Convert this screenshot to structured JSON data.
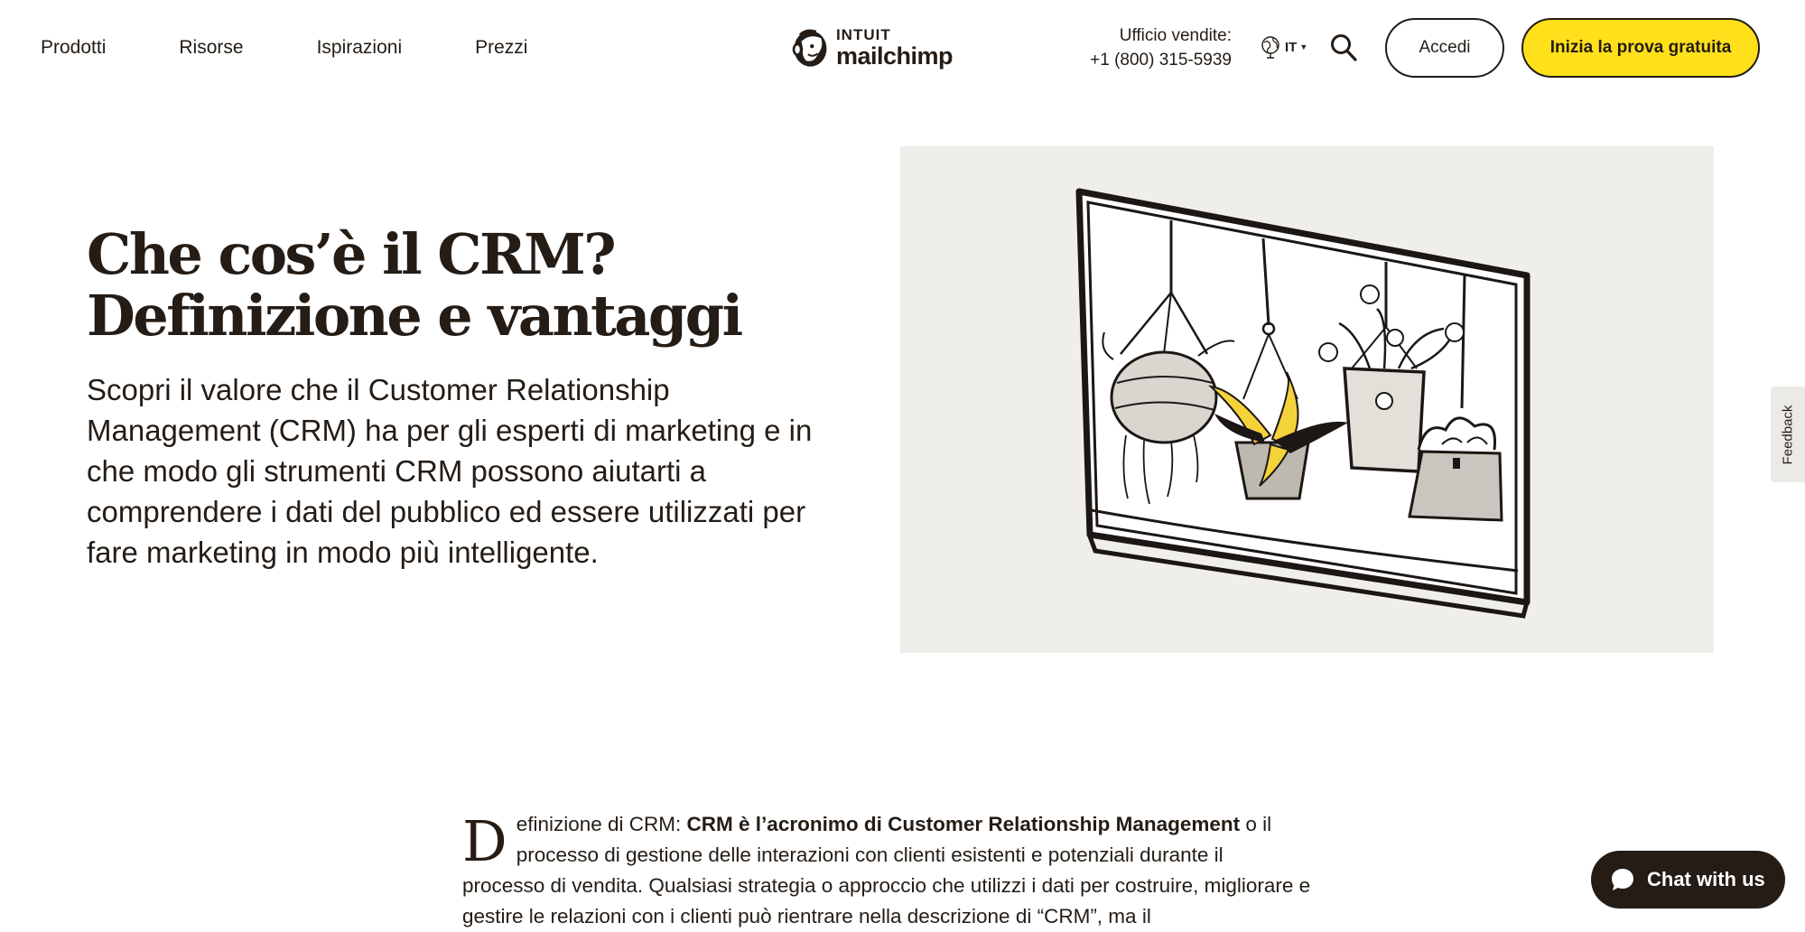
{
  "header": {
    "nav": [
      "Prodotti",
      "Risorse",
      "Ispirazioni",
      "Prezzi"
    ],
    "logo_intuit": "INTUIT",
    "logo_mailchimp": "mailchimp",
    "sales_label": "Ufficio vendite:",
    "sales_phone": "+1 (800) 315-5939",
    "language": "IT",
    "login_label": "Accedi",
    "trial_label": "Inizia la prova gratuita"
  },
  "hero": {
    "title_line1": "Che cos’è il CRM?",
    "title_line2": "Definizione e vantaggi",
    "subtitle": "Scopri il valore che il Customer Relationship Management (CRM) ha per gli esperti di marketing e in che modo gli strumenti CRM possono aiutarti a comprendere i dati del pubblico ed essere utilizzati per fare marketing in modo più intelligente."
  },
  "feedback_label": "Feedback",
  "article": {
    "dropcap": "D",
    "lead": "efinizione di CRM: ",
    "bold": "CRM è l’acronimo di Customer Relationship Management",
    "rest": " o il processo di gestione delle interazioni con clienti esistenti e potenziali durante il processo di vendita. Qualsiasi strategia o approccio che utilizzi i dati per costruire, migliorare e gestire le relazioni con i clienti può rientrare nella descrizione di “CRM”, ma il"
  },
  "chat_label": "Chat with us",
  "colors": {
    "accent_yellow": "#ffe01b",
    "ink": "#241c15",
    "illustration_bg": "#efeeea"
  },
  "icons": {
    "globe": "globe-icon",
    "search": "search-icon",
    "chat": "chat-bubble-icon",
    "logo": "freddie-monkey-icon"
  }
}
